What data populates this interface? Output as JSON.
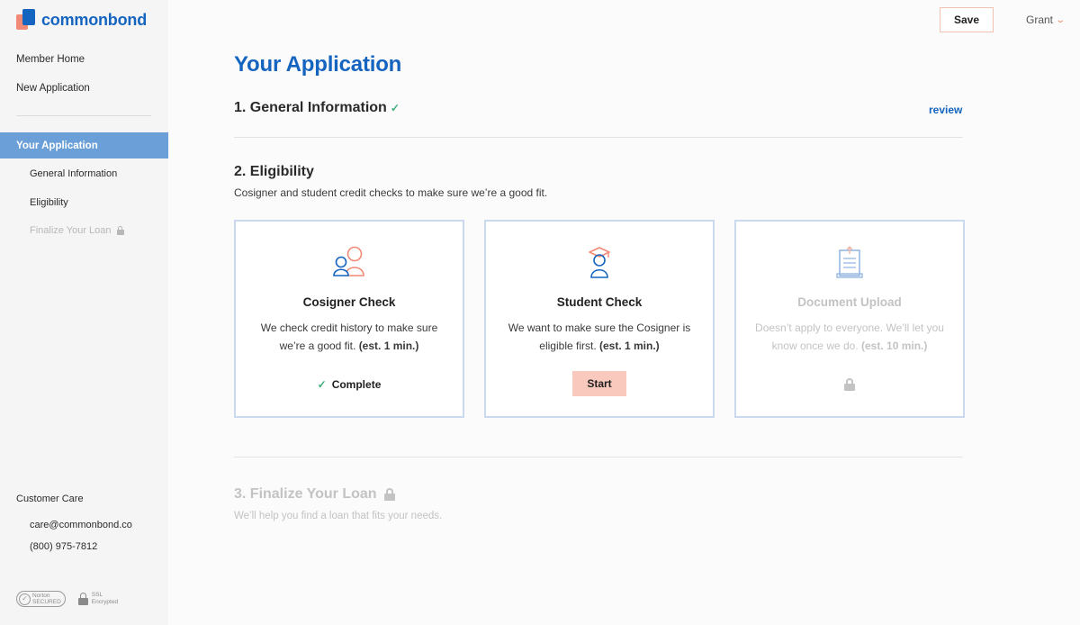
{
  "brand": {
    "name": "commonbond",
    "primary": "#1565c0",
    "accent": "#f08a76"
  },
  "header": {
    "save_label": "Save",
    "user_name": "Grant",
    "user_chevron_icon": "chevron-down-icon"
  },
  "sidebar": {
    "nav": [
      {
        "label": "Member Home"
      },
      {
        "label": "New Application"
      }
    ],
    "active": "Your Application",
    "sub_items": [
      {
        "label": "General Information",
        "locked": false
      },
      {
        "label": "Eligibility",
        "locked": false
      },
      {
        "label": "Finalize Your Loan",
        "locked": true
      }
    ],
    "care": {
      "title": "Customer Care",
      "email": "care@commonbond.co",
      "phone": "(800) 975-7812"
    },
    "badges": {
      "norton_line1": "Norton",
      "norton_line2": "SECURED",
      "ssl_line1": "SSL",
      "ssl_line2": "Encrypted"
    }
  },
  "main": {
    "title": "Your Application",
    "sections": [
      {
        "title": "1. General Information",
        "complete": true,
        "review_label": "review"
      },
      {
        "title": "2. Eligibility",
        "description": "Cosigner and student credit checks to make sure we’re a good fit."
      },
      {
        "title": "3. Finalize Your Loan",
        "description": "We’ll help you find a loan that fits your needs.",
        "locked": true
      }
    ],
    "cards": [
      {
        "title": "Cosigner Check",
        "desc": "We check credit history to make sure we’re a good fit.",
        "est": "(est. 1 min.)",
        "status": "Complete",
        "icon": "people-icon"
      },
      {
        "title": "Student Check",
        "desc": "We want to make sure the Cosigner is eligible first.",
        "est": "(est. 1 min.)",
        "action": "Start",
        "icon": "graduate-icon"
      },
      {
        "title": "Document Upload",
        "desc": "Doesn’t apply to everyone. We’ll let you know once we do.",
        "est": "(est. 10 min.)",
        "locked": true,
        "icon": "document-upload-icon"
      }
    ]
  }
}
